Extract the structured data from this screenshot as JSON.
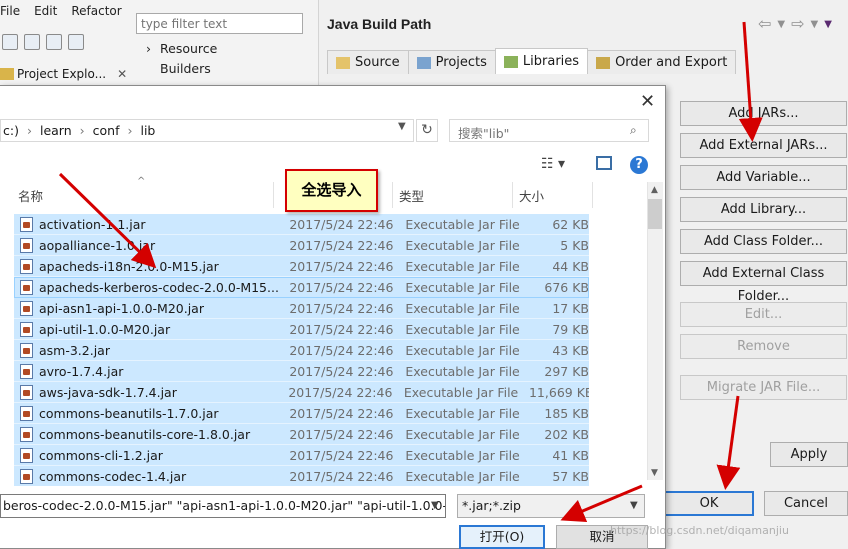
{
  "eclipse": {
    "menu": [
      "File",
      "Edit",
      "Refactor"
    ],
    "filter_placeholder": "type filter text",
    "tree": [
      "Resource",
      "Builders"
    ],
    "project_tab": "Project Explo..."
  },
  "build_path": {
    "title": "Java Build Path",
    "tabs": [
      "Source",
      "Projects",
      "Libraries",
      "Order and Export"
    ],
    "active_tab": "Libraries",
    "buttons": {
      "add_jars": "Add JARs...",
      "add_external_jars": "Add External JARs...",
      "add_variable": "Add Variable...",
      "add_library": "Add Library...",
      "add_class_folder": "Add Class Folder...",
      "add_external_class_folder": "Add External Class Folder...",
      "edit": "Edit...",
      "remove": "Remove",
      "migrate": "Migrate JAR File..."
    },
    "apply": "Apply",
    "ok": "OK",
    "cancel": "Cancel"
  },
  "dialog": {
    "path": [
      "c:)",
      "learn",
      "conf",
      "lib"
    ],
    "search_placeholder": "搜索\"lib\"",
    "columns": {
      "name": "名称",
      "type": "类型",
      "size": "大小"
    },
    "files": [
      {
        "name": "activation-1.1.jar",
        "date": "2017/5/24 22:46",
        "type": "Executable Jar File",
        "size": "62 KB"
      },
      {
        "name": "aopalliance-1.0.jar",
        "date": "2017/5/24 22:46",
        "type": "Executable Jar File",
        "size": "5 KB"
      },
      {
        "name": "apacheds-i18n-2.0.0-M15.jar",
        "date": "2017/5/24 22:46",
        "type": "Executable Jar File",
        "size": "44 KB"
      },
      {
        "name": "apacheds-kerberos-codec-2.0.0-M15...",
        "date": "2017/5/24 22:46",
        "type": "Executable Jar File",
        "size": "676 KB"
      },
      {
        "name": "api-asn1-api-1.0.0-M20.jar",
        "date": "2017/5/24 22:46",
        "type": "Executable Jar File",
        "size": "17 KB"
      },
      {
        "name": "api-util-1.0.0-M20.jar",
        "date": "2017/5/24 22:46",
        "type": "Executable Jar File",
        "size": "79 KB"
      },
      {
        "name": "asm-3.2.jar",
        "date": "2017/5/24 22:46",
        "type": "Executable Jar File",
        "size": "43 KB"
      },
      {
        "name": "avro-1.7.4.jar",
        "date": "2017/5/24 22:46",
        "type": "Executable Jar File",
        "size": "297 KB"
      },
      {
        "name": "aws-java-sdk-1.7.4.jar",
        "date": "2017/5/24 22:46",
        "type": "Executable Jar File",
        "size": "11,669 KB"
      },
      {
        "name": "commons-beanutils-1.7.0.jar",
        "date": "2017/5/24 22:46",
        "type": "Executable Jar File",
        "size": "185 KB"
      },
      {
        "name": "commons-beanutils-core-1.8.0.jar",
        "date": "2017/5/24 22:46",
        "type": "Executable Jar File",
        "size": "202 KB"
      },
      {
        "name": "commons-cli-1.2.jar",
        "date": "2017/5/24 22:46",
        "type": "Executable Jar File",
        "size": "41 KB"
      },
      {
        "name": "commons-codec-1.4.jar",
        "date": "2017/5/24 22:46",
        "type": "Executable Jar File",
        "size": "57 KB"
      }
    ],
    "filename_value": "beros-codec-2.0.0-M15.jar\" \"api-asn1-api-1.0.0-M20.jar\" \"api-util-1.0.0-M",
    "filter_value": "*.jar;*.zip",
    "open": "打开(O)",
    "cancel": "取消"
  },
  "annotation": {
    "callout": "全选导入",
    "color": "#d40000"
  },
  "watermark": "https://blog.csdn.net/diqamanjiu"
}
